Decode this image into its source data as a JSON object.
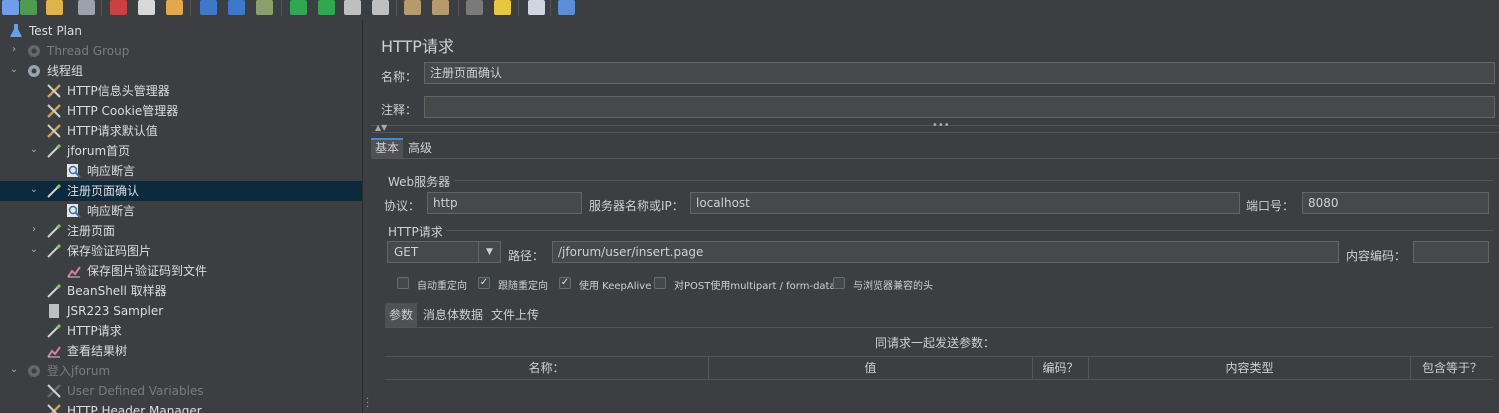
{
  "toolbar": {
    "icons": [
      "new-icon",
      "templates-icon",
      "open-icon",
      "save-icon",
      "cut-icon",
      "copy-icon",
      "paste-icon",
      "expand-icon",
      "collapse-icon",
      "toggle-icon",
      "start-icon",
      "start-no-pause-icon",
      "stop-icon",
      "shutdown-icon",
      "clear-icon",
      "clear-all-icon",
      "search-icon",
      "reset-search-icon",
      "function-helper-icon",
      "help-icon"
    ]
  },
  "tree": {
    "items": [
      {
        "label": "Test Plan",
        "icon": "flask-icon",
        "level": 0,
        "chev": "",
        "dim": false
      },
      {
        "label": "Thread Group",
        "icon": "gear-icon",
        "level": 1,
        "chev": "›",
        "dim": true
      },
      {
        "label": "线程组",
        "icon": "gear-icon",
        "level": 1,
        "chev": "⌄",
        "dim": false
      },
      {
        "label": "HTTP信息头管理器",
        "icon": "wrench-icon",
        "level": 2,
        "chev": "",
        "dim": false
      },
      {
        "label": "HTTP Cookie管理器",
        "icon": "wrench-icon",
        "level": 2,
        "chev": "",
        "dim": false
      },
      {
        "label": "HTTP请求默认值",
        "icon": "wrench-icon",
        "level": 2,
        "chev": "",
        "dim": false
      },
      {
        "label": "jforum首页",
        "icon": "pipette-icon",
        "level": 2,
        "chev": "⌄",
        "dim": false
      },
      {
        "label": "响应断言",
        "icon": "magnifier-icon",
        "level": 3,
        "chev": "",
        "dim": false
      },
      {
        "label": "注册页面确认",
        "icon": "pipette-icon",
        "level": 2,
        "chev": "⌄",
        "dim": false,
        "selected": true
      },
      {
        "label": "响应断言",
        "icon": "magnifier-icon",
        "level": 3,
        "chev": "",
        "dim": false
      },
      {
        "label": "注册页面",
        "icon": "pipette-icon",
        "level": 2,
        "chev": "›",
        "dim": false
      },
      {
        "label": "保存验证码图片",
        "icon": "pipette-icon",
        "level": 2,
        "chev": "⌄",
        "dim": false
      },
      {
        "label": "保存图片验证码到文件",
        "icon": "graph-icon",
        "level": 3,
        "chev": "",
        "dim": false
      },
      {
        "label": "BeanShell 取样器",
        "icon": "pipette-icon",
        "level": 2,
        "chev": "",
        "dim": false
      },
      {
        "label": "JSR223 Sampler",
        "icon": "page-icon",
        "level": 2,
        "chev": "",
        "dim": false
      },
      {
        "label": "HTTP请求",
        "icon": "pipette-icon",
        "level": 2,
        "chev": "",
        "dim": false
      },
      {
        "label": "查看结果树",
        "icon": "graph-icon",
        "level": 2,
        "chev": "",
        "dim": false
      },
      {
        "label": "登入jforum",
        "icon": "gear-icon",
        "level": 1,
        "chev": "⌄",
        "dim": true
      },
      {
        "label": "User Defined Variables",
        "icon": "wrench-icon",
        "level": 2,
        "chev": "",
        "dim": true
      },
      {
        "label": "HTTP Header Manager",
        "icon": "wrench-icon",
        "level": 2,
        "chev": "",
        "dim": false
      }
    ]
  },
  "panel": {
    "title": "HTTP请求",
    "name_label": "名称：",
    "name_value": "注册页面确认",
    "comment_label": "注释：",
    "comment_value": "",
    "tabs": [
      "基本",
      "高级"
    ],
    "web_server_group": "Web服务器",
    "protocol_label": "协议：",
    "protocol_value": "http",
    "server_label": "服务器名称或IP：",
    "server_value": "localhost",
    "port_label": "端口号：",
    "port_value": "8080",
    "http_request_group": "HTTP请求",
    "method_value": "GET",
    "path_label": "路径：",
    "path_value": "/jforum/user/insert.page",
    "encoding_label": "内容编码：",
    "encoding_value": "",
    "checkboxes": [
      {
        "label": "自动重定向",
        "checked": false
      },
      {
        "label": "跟随重定向",
        "checked": true
      },
      {
        "label": "使用 KeepAlive",
        "checked": true
      },
      {
        "label": "对POST使用multipart / form-data",
        "checked": false
      },
      {
        "label": "与浏览器兼容的头",
        "checked": false
      }
    ],
    "param_tabs": [
      "参数",
      "消息体数据",
      "文件上传"
    ],
    "table_title": "同请求一起发送参数：",
    "columns": [
      "名称：",
      "值",
      "编码？",
      "内容类型",
      "包含等于？"
    ]
  }
}
